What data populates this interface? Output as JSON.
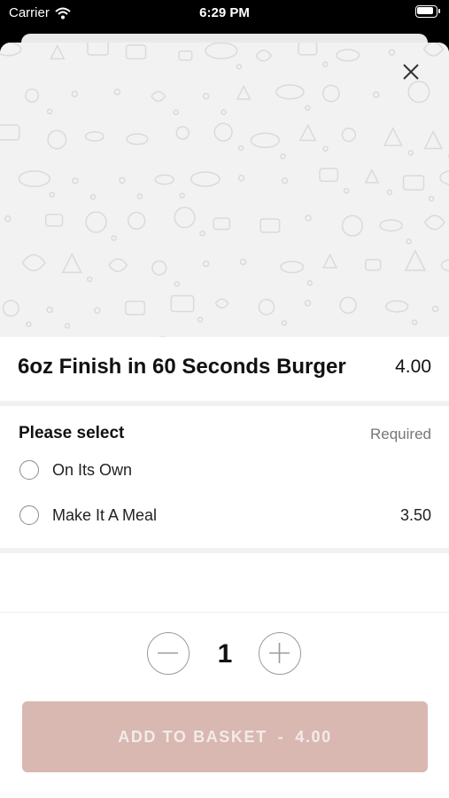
{
  "status_bar": {
    "carrier": "Carrier",
    "time": "6:29 PM",
    "icons": [
      "wifi-icon",
      "battery-icon"
    ]
  },
  "hero": {
    "pattern_icon": "food-doodle-pattern",
    "close_icon": "close-icon"
  },
  "item": {
    "name": "6oz Finish in 60 Seconds Burger",
    "price": "4.00"
  },
  "options": {
    "title": "Please select",
    "required_label": "Required",
    "items": [
      {
        "label": "On Its Own",
        "price": ""
      },
      {
        "label": "Make It A Meal",
        "price": "3.50"
      }
    ]
  },
  "quantity": {
    "value": "1",
    "minus_icon": "minus-icon",
    "plus_icon": "plus-icon"
  },
  "add_button": {
    "label": "ADD TO BASKET",
    "separator": "-",
    "price": "4.00"
  },
  "colors": {
    "accent_disabled": "#d8b8b1",
    "hero_bg": "#f2f2f2",
    "pattern_stroke": "#dadada"
  }
}
